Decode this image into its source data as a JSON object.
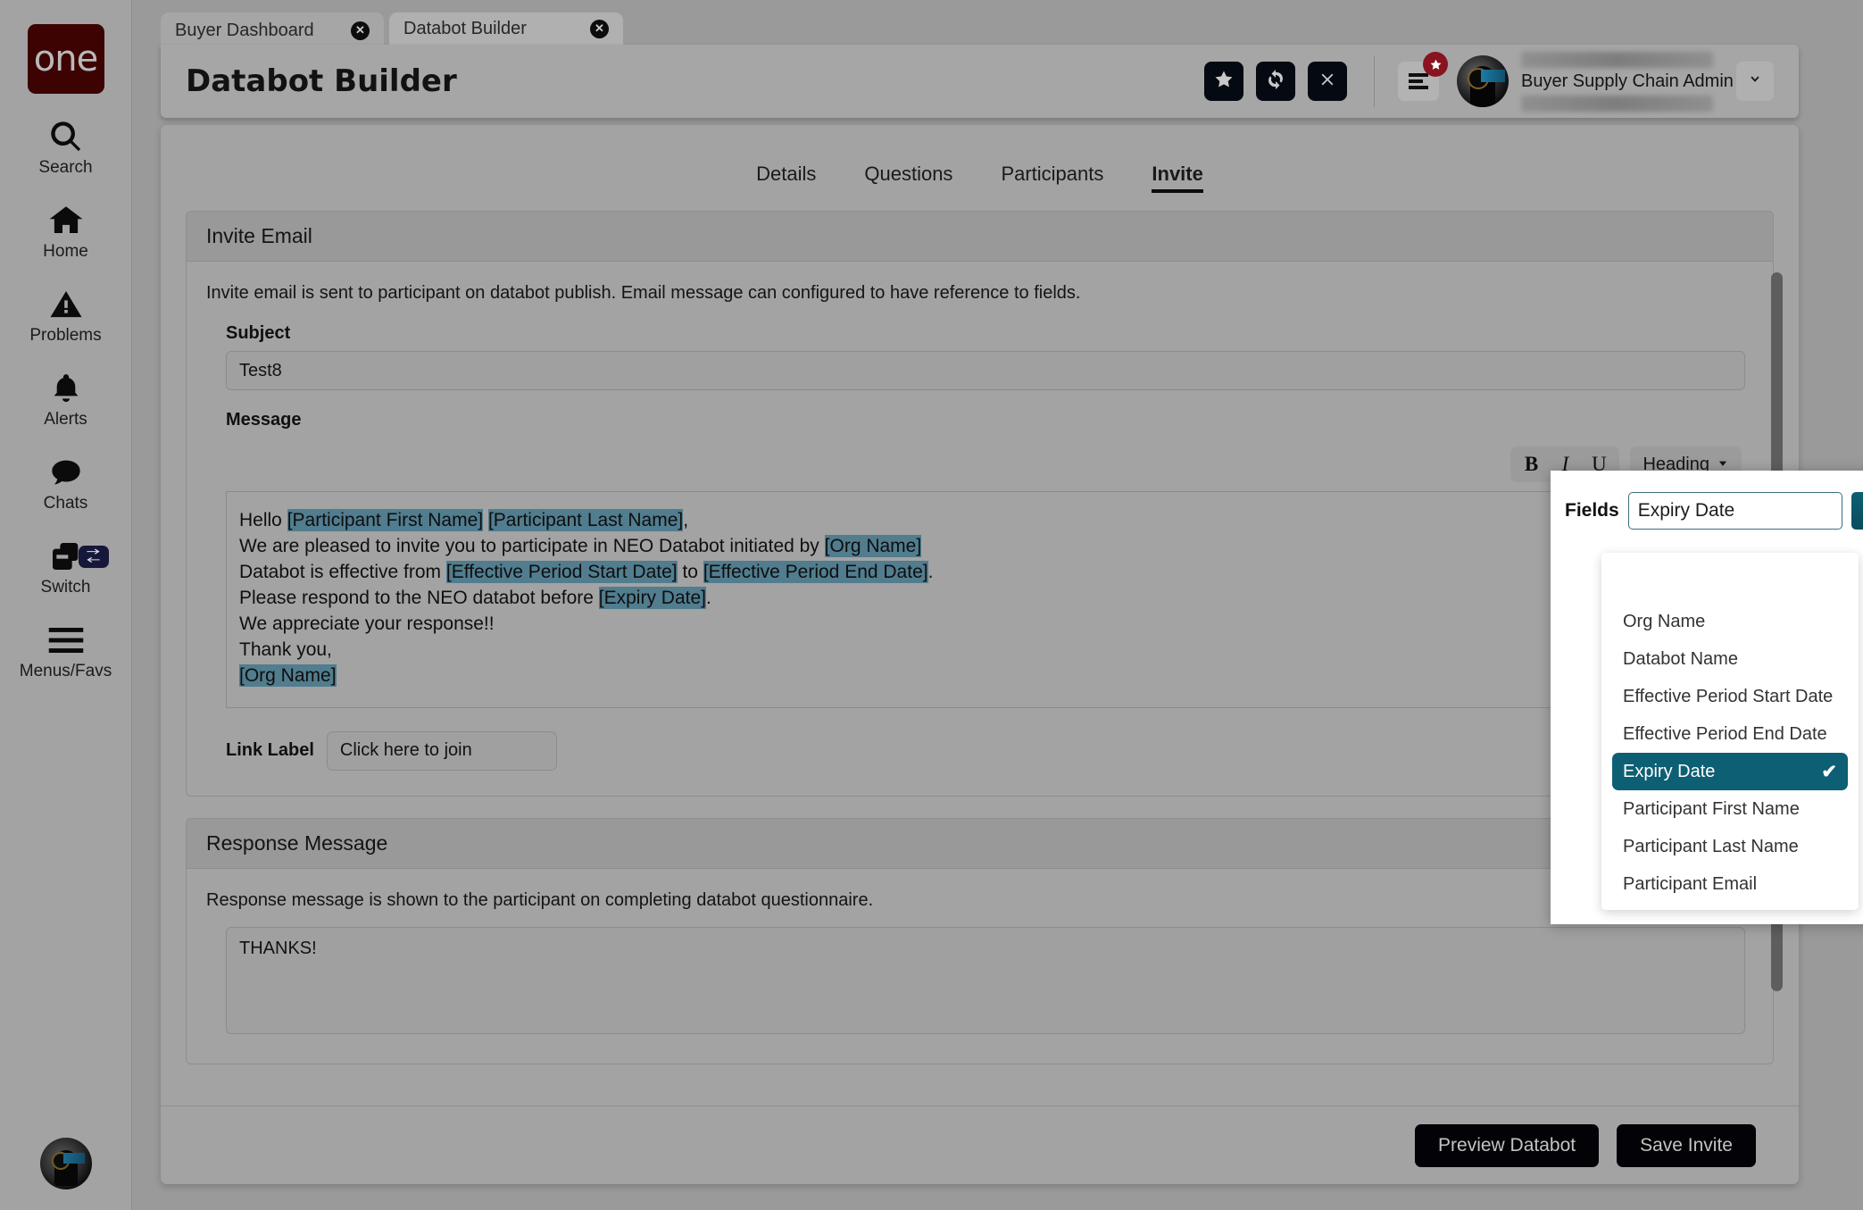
{
  "brand": {
    "logo_text": "one"
  },
  "sidebar": {
    "items": [
      {
        "label": "Search",
        "icon": "search-icon"
      },
      {
        "label": "Home",
        "icon": "home-icon"
      },
      {
        "label": "Problems",
        "icon": "warning-triangle-icon"
      },
      {
        "label": "Alerts",
        "icon": "bell-icon"
      },
      {
        "label": "Chats",
        "icon": "chat-bubble-icon"
      },
      {
        "label": "Switch",
        "icon": "switch-windows-icon",
        "badge_icon": "swap-arrows-icon"
      },
      {
        "label": "Menus/Favs",
        "icon": "hamburger-icon"
      }
    ]
  },
  "browser_tabs": [
    {
      "label": "Buyer Dashboard",
      "active": false,
      "close_icon": "close-icon"
    },
    {
      "label": "Databot Builder",
      "active": true,
      "close_icon": "close-icon"
    }
  ],
  "header": {
    "title": "Databot Builder",
    "actions": [
      {
        "name": "favorite-button",
        "icon": "star-icon"
      },
      {
        "name": "refresh-button",
        "icon": "refresh-icon"
      },
      {
        "name": "close-button",
        "icon": "close-x-icon"
      }
    ],
    "menu_button_icon": "menu-lines-icon",
    "menu_badge_icon": "star-icon",
    "user_role": "Buyer Supply Chain Admin",
    "user_caret_icon": "chevron-down-icon"
  },
  "page_tabs": [
    {
      "label": "Details",
      "active": false
    },
    {
      "label": "Questions",
      "active": false
    },
    {
      "label": "Participants",
      "active": false
    },
    {
      "label": "Invite",
      "active": true
    }
  ],
  "invite_email": {
    "section_title": "Invite Email",
    "description": "Invite email is sent to participant on databot publish. Email message can configured to have reference to fields.",
    "subject_label": "Subject",
    "subject_value": "Test8",
    "subject_placeholder": "",
    "message_label": "Message",
    "toolbar": {
      "bold_label": "B",
      "italic_label": "I",
      "underline_label": "U",
      "heading_label": "Heading",
      "heading_caret_icon": "caret-down-icon"
    },
    "message_lines": [
      [
        {
          "t": "Hello ",
          "h": false
        },
        {
          "t": "[Participant First Name]",
          "h": true
        },
        {
          "t": " ",
          "h": false
        },
        {
          "t": "[Participant Last Name]",
          "h": true
        },
        {
          "t": ",",
          "h": false
        }
      ],
      [
        {
          "t": "We are pleased to invite you to participate in NEO Databot initiated by ",
          "h": false
        },
        {
          "t": "[Org Name]",
          "h": true
        }
      ],
      [
        {
          "t": "Databot is effective from ",
          "h": false
        },
        {
          "t": "[Effective Period Start Date]",
          "h": true
        },
        {
          "t": " to ",
          "h": false
        },
        {
          "t": "[Effective Period End Date]",
          "h": true
        },
        {
          "t": ".",
          "h": false
        }
      ],
      [
        {
          "t": "Please respond to the NEO databot before ",
          "h": false
        },
        {
          "t": "[Expiry Date]",
          "h": true
        },
        {
          "t": ".",
          "h": false
        }
      ],
      [
        {
          "t": "We appreciate your response!!",
          "h": false
        }
      ],
      [
        {
          "t": "Thank you,",
          "h": false
        }
      ],
      [
        {
          "t": "[Org Name]",
          "h": true
        }
      ]
    ],
    "link_label_label": "Link Label",
    "link_label_value": "Click here to join",
    "link_label_placeholder": ""
  },
  "fields_popover": {
    "label": "Fields",
    "input_value": "Expiry Date",
    "input_placeholder": "",
    "caret_icon": "chevron-up-icon",
    "check_icon": "check-icon",
    "options": [
      {
        "label": "Org Name",
        "selected": false
      },
      {
        "label": "Databot Name",
        "selected": false
      },
      {
        "label": "Effective Period Start Date",
        "selected": false
      },
      {
        "label": "Effective Period End Date",
        "selected": false
      },
      {
        "label": "Expiry Date",
        "selected": true
      },
      {
        "label": "Participant First Name",
        "selected": false
      },
      {
        "label": "Participant Last Name",
        "selected": false
      },
      {
        "label": "Participant Email",
        "selected": false
      }
    ]
  },
  "response_message": {
    "section_title": "Response Message",
    "description": "Response message is shown to the participant on completing databot questionnaire.",
    "value": "THANKS!",
    "placeholder": ""
  },
  "footer": {
    "preview_label": "Preview Databot",
    "save_label": "Save Invite"
  },
  "colors": {
    "accent_teal": "#0d5f73",
    "token_highlight": "#517d8f",
    "brand_maroon": "#3d0303",
    "badge_red": "#8a1320",
    "dark_button": "#030307"
  }
}
